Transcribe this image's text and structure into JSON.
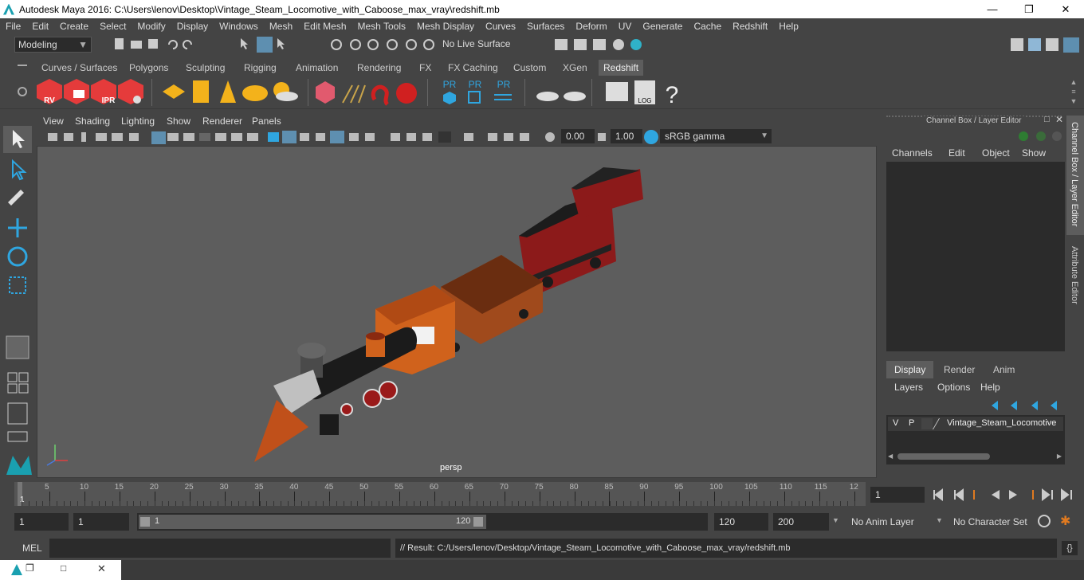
{
  "window": {
    "title": "Autodesk Maya 2016: C:\\Users\\lenov\\Desktop\\Vintage_Steam_Locomotive_with_Caboose_max_vray\\redshift.mb"
  },
  "menubar": [
    "File",
    "Edit",
    "Create",
    "Select",
    "Modify",
    "Display",
    "Windows",
    "Mesh",
    "Edit Mesh",
    "Mesh Tools",
    "Mesh Display",
    "Curves",
    "Surfaces",
    "Deform",
    "UV",
    "Generate",
    "Cache",
    "Redshift",
    "Help"
  ],
  "statusline": {
    "mode": "Modeling",
    "live_surface": "No Live Surface"
  },
  "shelf_tabs": [
    "Curves / Surfaces",
    "Polygons",
    "Sculpting",
    "Rigging",
    "Animation",
    "Rendering",
    "FX",
    "FX Caching",
    "Custom",
    "XGen",
    "Redshift"
  ],
  "shelf_active": "Redshift",
  "shelf_labels": {
    "rv": "RV",
    "ipr": "IPR",
    "pr": "PR",
    "log": "LOG",
    "help": "?"
  },
  "viewport": {
    "menu": [
      "View",
      "Shading",
      "Lighting",
      "Show",
      "Renderer",
      "Panels"
    ],
    "exposure": "0.00",
    "gamma": "1.00",
    "color_space": "sRGB gamma",
    "camera": "persp"
  },
  "channel_box": {
    "title": "Channel Box / Layer Editor",
    "menu": [
      "Channels",
      "Edit",
      "Object",
      "Show"
    ],
    "layer_tabs": [
      "Display",
      "Render",
      "Anim"
    ],
    "layer_menu": [
      "Layers",
      "Options",
      "Help"
    ],
    "layer": {
      "v": "V",
      "p": "P",
      "name": "Vintage_Steam_Locomotive"
    }
  },
  "side_tabs": [
    "Channel Box / Layer Editor",
    "Attribute Editor"
  ],
  "timeline": {
    "ticks": [
      "5",
      "10",
      "15",
      "20",
      "25",
      "30",
      "35",
      "40",
      "45",
      "50",
      "55",
      "60",
      "65",
      "70",
      "75",
      "80",
      "85",
      "90",
      "95",
      "100",
      "105",
      "110",
      "115",
      "12"
    ],
    "current_frame": "1",
    "frame_field": "1"
  },
  "range": {
    "start": "1",
    "start2": "1",
    "slider_start": "1",
    "slider_end": "120",
    "end": "120",
    "max": "200",
    "anim_layer": "No Anim Layer",
    "character_set": "No Character Set"
  },
  "cmdline": {
    "label": "MEL",
    "result": "// Result: C:/Users/lenov/Desktop/Vintage_Steam_Locomotive_with_Caboose_max_vray/redshift.mb"
  }
}
